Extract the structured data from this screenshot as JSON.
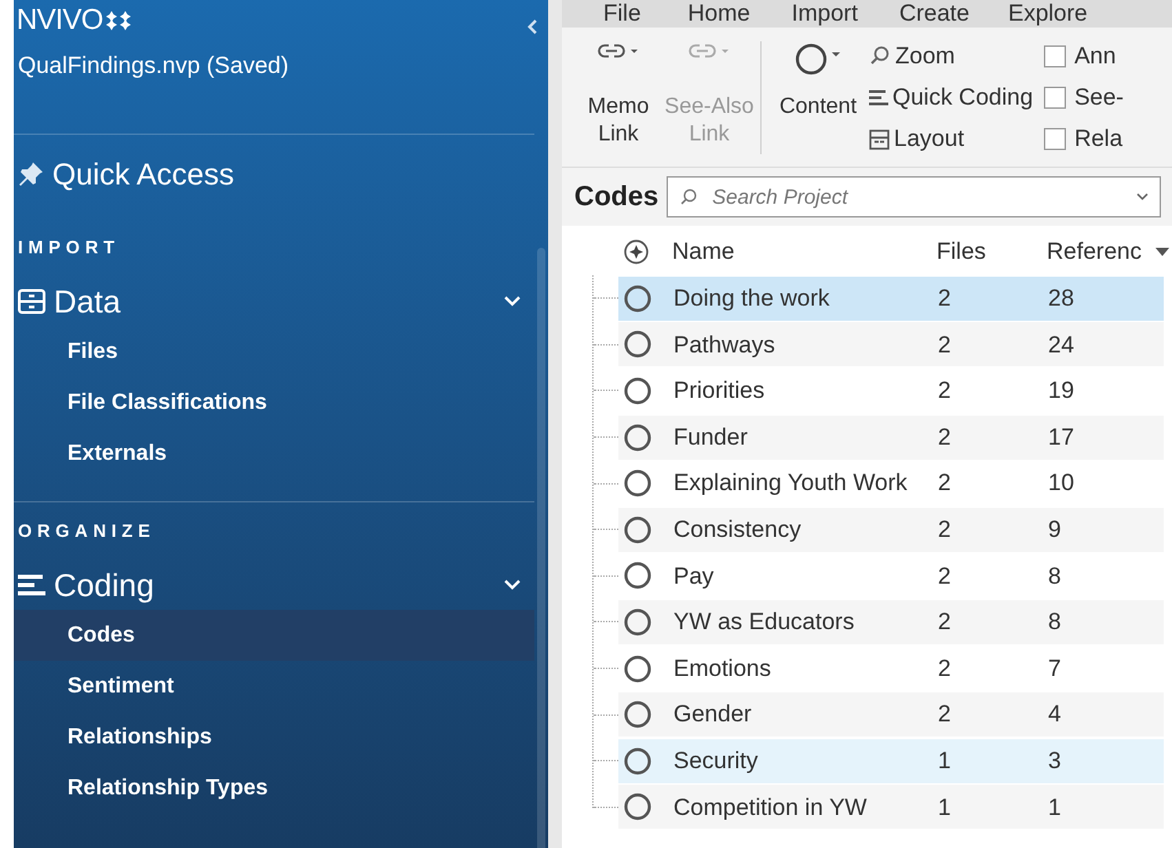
{
  "sidebar": {
    "logo": "NVIVO",
    "project": "QualFindings.nvp (Saved)",
    "quick_access": "Quick Access",
    "sections": [
      {
        "heading": "IMPORT",
        "group": {
          "label": "Data",
          "kind": "data",
          "expanded": true,
          "items": [
            {
              "label": "Files",
              "selected": false
            },
            {
              "label": "File Classifications",
              "selected": false
            },
            {
              "label": "Externals",
              "selected": false
            }
          ]
        }
      },
      {
        "heading": "ORGANIZE",
        "group": {
          "label": "Coding",
          "kind": "coding",
          "expanded": true,
          "items": [
            {
              "label": "Codes",
              "selected": true
            },
            {
              "label": "Sentiment",
              "selected": false
            },
            {
              "label": "Relationships",
              "selected": false
            },
            {
              "label": "Relationship Types",
              "selected": false
            }
          ]
        }
      }
    ]
  },
  "menu_tabs": [
    "File",
    "Home",
    "Import",
    "Create",
    "Explore"
  ],
  "ribbon": {
    "link_buttons": [
      {
        "label": "Memo Link",
        "disabled": false
      },
      {
        "label": "See-Also Link",
        "disabled": true
      }
    ],
    "content_button": "Content",
    "small_buttons": [
      {
        "label": "Zoom",
        "kind": "zoom"
      },
      {
        "label": "Quick Coding",
        "kind": "lines"
      },
      {
        "label": "Layout",
        "kind": "layout"
      }
    ],
    "checkboxes": [
      {
        "label": "Ann",
        "checked": false
      },
      {
        "label": "See-",
        "checked": false
      },
      {
        "label": "Rela",
        "checked": false
      }
    ]
  },
  "codes": {
    "title": "Codes",
    "search": {
      "placeholder": "Search Project"
    },
    "columns": [
      "Name",
      "Files",
      "Referenc"
    ],
    "rows": [
      {
        "name": "Doing the work",
        "files": "2",
        "references": "28",
        "selected": true,
        "hovered": false
      },
      {
        "name": "Pathways",
        "files": "2",
        "references": "24",
        "selected": false,
        "hovered": false
      },
      {
        "name": "Priorities",
        "files": "2",
        "references": "19",
        "selected": false,
        "hovered": false
      },
      {
        "name": "Funder",
        "files": "2",
        "references": "17",
        "selected": false,
        "hovered": false
      },
      {
        "name": "Explaining Youth Work",
        "files": "2",
        "references": "10",
        "selected": false,
        "hovered": false
      },
      {
        "name": "Consistency",
        "files": "2",
        "references": "9",
        "selected": false,
        "hovered": false
      },
      {
        "name": "Pay",
        "files": "2",
        "references": "8",
        "selected": false,
        "hovered": false
      },
      {
        "name": "YW as Educators",
        "files": "2",
        "references": "8",
        "selected": false,
        "hovered": false
      },
      {
        "name": "Emotions",
        "files": "2",
        "references": "7",
        "selected": false,
        "hovered": false
      },
      {
        "name": "Gender",
        "files": "2",
        "references": "4",
        "selected": false,
        "hovered": false
      },
      {
        "name": "Security",
        "files": "1",
        "references": "3",
        "selected": false,
        "hovered": true
      },
      {
        "name": "Competition in YW",
        "files": "1",
        "references": "1",
        "selected": false,
        "hovered": false
      }
    ]
  }
}
